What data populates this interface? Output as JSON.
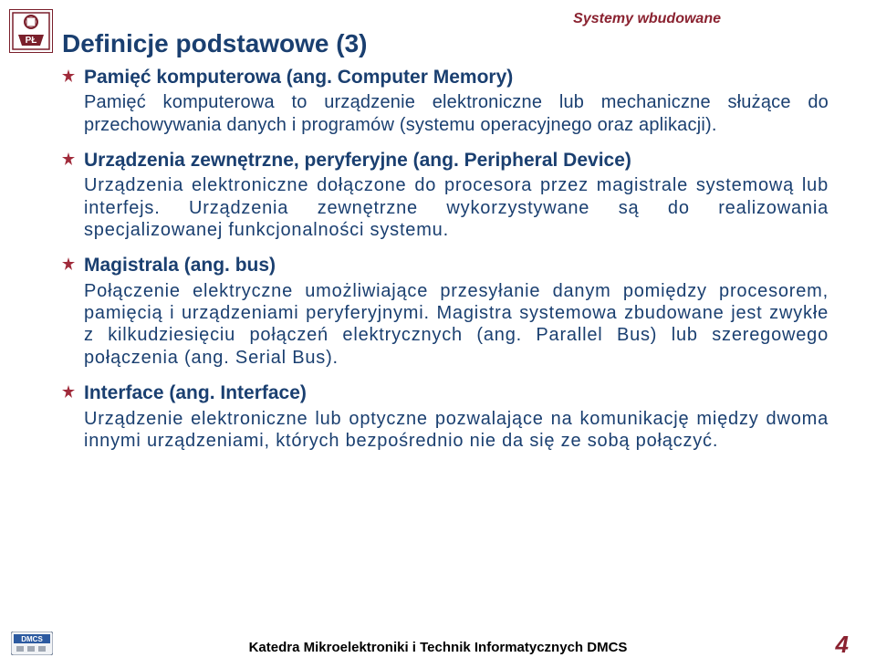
{
  "header": {
    "course": "Systemy wbudowane"
  },
  "title": "Definicje podstawowe (3)",
  "items": [
    {
      "heading": "Pamięć komputerowa (ang. Computer Memory)",
      "body": "Pamięć komputerowa to urządzenie elektroniczne lub mechaniczne służące do przechowywania danych i programów (systemu operacyjnego oraz aplikacji)."
    },
    {
      "heading": "Urządzenia zewnętrzne, peryferyjne (ang. Peripheral Device)",
      "body": "Urządzenia elektroniczne dołączone do procesora przez magistrale systemową lub interfejs. Urządzenia zewnętrzne wykorzystywane są do realizowania specjalizowanej funkcjonalności systemu."
    },
    {
      "heading": "Magistrala (ang. bus)",
      "body": "Połączenie elektryczne umożliwiające przesyłanie danym pomiędzy procesorem, pamięcią i urządzeniami peryferyjnymi. Magistra systemowa zbudowane jest zwykłe z kilkudziesięciu połączeń elektrycznych (ang. Parallel Bus) lub szeregowego połączenia (ang. Serial Bus)."
    },
    {
      "heading": "Interface (ang. Interface)",
      "body": "Urządzenie elektroniczne lub optyczne pozwalające na komunikację między dwoma innymi urządzeniami, których bezpośrednio nie da się ze sobą połączyć."
    }
  ],
  "footer": {
    "text": "Katedra Mikroelektroniki i Technik Informatycznych DMCS",
    "page": "4"
  }
}
